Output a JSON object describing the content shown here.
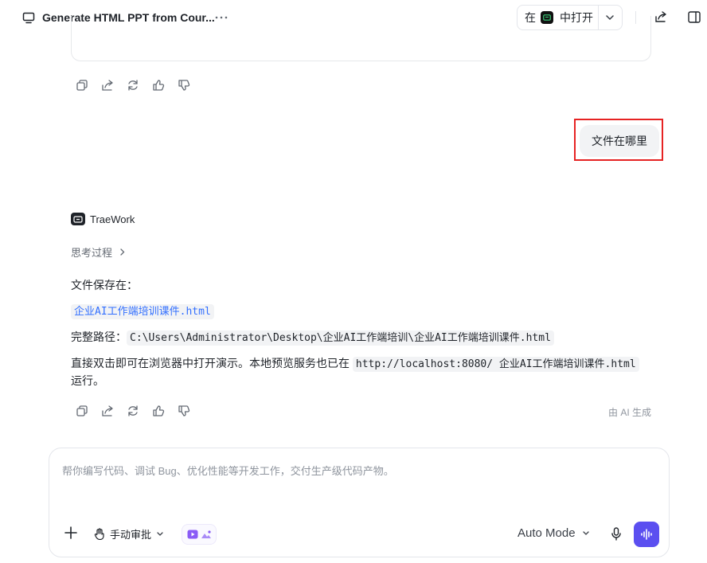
{
  "header": {
    "title": "Generate HTML PPT from Cour...",
    "open_prefix": "在",
    "open_label": "中打开"
  },
  "conversation": {
    "user_message": "文件在哪里",
    "agent_name": "TraeWork",
    "thinking_label": "思考过程",
    "line1": "文件保存在：",
    "file_link": "企业AI工作端培训课件.html",
    "path_label": "完整路径：",
    "path_value": "C:\\Users\\Administrator\\Desktop\\企业AI工作端培训\\企业AI工作端培训课件.html",
    "line3_prefix": "直接双击即可在浏览器中打开演示。本地预览服务也已在",
    "line3_code": "http://localhost:8080/ 企业AI工作端培训课件.html",
    "line3_suffix": "运行。",
    "ai_generated": "由 AI 生成"
  },
  "composer": {
    "placeholder": "帮你编写代码、调试 Bug、优化性能等开发工作，交付生产级代码产物。",
    "approve_label": "手动审批",
    "mode_label": "Auto Mode"
  },
  "icons": [
    "monitor-icon",
    "more-icon",
    "app-icon",
    "chevron-down-icon",
    "share-icon",
    "sidebar-toggle-icon",
    "copy-icon",
    "reply-icon",
    "refresh-icon",
    "thumbs-up-icon",
    "thumbs-down-icon",
    "plus-icon",
    "hand-icon",
    "video-icon",
    "image-icon",
    "mic-icon",
    "voice-wave-icon"
  ],
  "colors": {
    "accent": "#5b4ff0",
    "link": "#3370ff",
    "highlight": "#e62323"
  }
}
